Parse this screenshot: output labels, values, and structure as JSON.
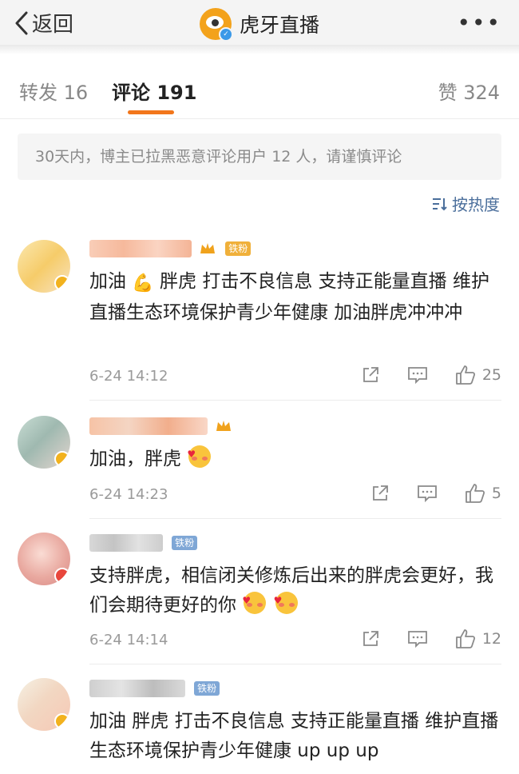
{
  "header": {
    "back_label": "返回",
    "account_name": "虎牙直播"
  },
  "tabs": {
    "repost": "转发 16",
    "comments": "评论 191",
    "likes": "赞 324"
  },
  "notice": "30天内，博主已拉黑恶意评论用户 12 人，请谨慎评论",
  "sort_label": "按热度",
  "fan_tag": "铁粉",
  "comments": [
    {
      "text_a": "加油",
      "text_b": " 胖虎  打击不良信息  支持正能量直播  维护直播生态环境保护青少年健康  加油胖虎冲冲冲",
      "time": "6-24 14:12",
      "likes": "25"
    },
    {
      "text_a": "加油，胖虎",
      "time": "6-24 14:23",
      "likes": "5"
    },
    {
      "text_a": "支持胖虎，相信闭关修炼后出来的胖虎会更好，我们会期待更好的你",
      "time": "6-24 14:14",
      "likes": "12"
    },
    {
      "text_a": "加油 胖虎  打击不良信息  支持正能量直播 维护直播生态环境保护青少年健康  up up up"
    }
  ],
  "colors": {
    "accent": "#f2761b",
    "link": "#4a6e9b"
  }
}
